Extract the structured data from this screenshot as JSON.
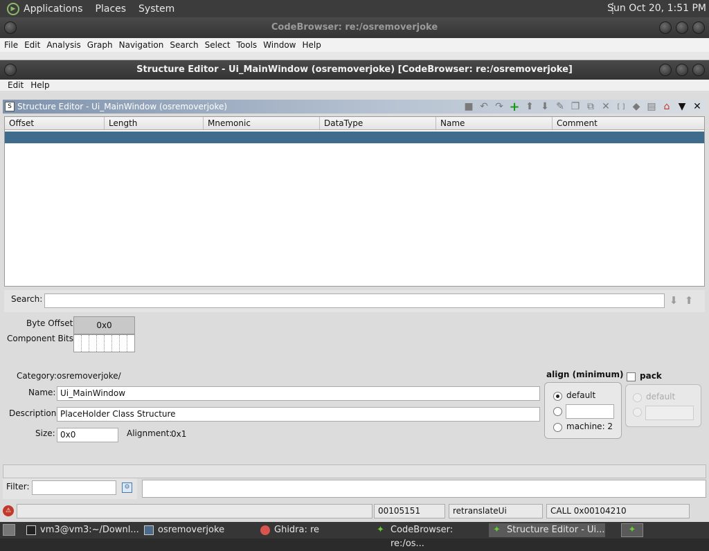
{
  "topbar": {
    "menus": [
      "Applications",
      "Places",
      "System"
    ],
    "clock": "Sun Oct 20,  1:51 PM"
  },
  "codebrowser": {
    "title": "CodeBrowser: re:/osremoverjoke",
    "menu": [
      "File",
      "Edit",
      "Analysis",
      "Graph",
      "Navigation",
      "Search",
      "Select",
      "Tools",
      "Window",
      "Help"
    ]
  },
  "structure_editor": {
    "title": "Structure Editor - Ui_MainWindow (osremoverjoke) [CodeBrowser: re:/osremoverjoke]",
    "menu": [
      "Edit",
      "Help"
    ],
    "panel_title": "Structure Editor - Ui_MainWindow (osremoverjoke)",
    "panel_icon": "structure-icon",
    "toolbar_icons": [
      "apply-icon",
      "undo-icon",
      "redo-icon",
      "add-icon",
      "move-up-icon",
      "move-down-icon",
      "duplicate-icon",
      "duplicate-multiple-icon",
      "unpackage-icon",
      "delete-icon",
      "array-icon",
      "create-pointer-icon",
      "show-components-icon",
      "home-icon",
      "menu-icon",
      "close-icon"
    ],
    "columns": [
      "Offset",
      "Length",
      "Mnemonic",
      "DataType",
      "Name",
      "Comment"
    ],
    "search_label": "Search:",
    "byte_offset_label": "Byte Offset:",
    "byte_offset_value": "0x0",
    "component_bits_label": "Component Bits:",
    "category_label": "Category:",
    "category_value": "osremoverjoke/",
    "name_label": "Name:",
    "name_value": "Ui_MainWindow",
    "description_label": "Description:",
    "description_value": "PlaceHolder Class Structure",
    "size_label": "Size:",
    "size_value": "0x0",
    "alignment_label": "Alignment:",
    "alignment_value": "0x1",
    "align_title": "align (minimum)",
    "align_options": [
      "default",
      "",
      "machine: 2"
    ],
    "pack_label": "pack",
    "pack_options": [
      "default",
      ""
    ],
    "filter_label": "Filter:"
  },
  "statusbar": {
    "address": "00105151",
    "function": "retranslateUi",
    "instruction": "CALL 0x00104210"
  },
  "taskbar": [
    {
      "label": "vm3@vm3:~/Downl...",
      "icon": "terminal-icon"
    },
    {
      "label": "osremoverjoke",
      "icon": "window-icon"
    },
    {
      "label": "Ghidra: re",
      "icon": "ghidra-icon"
    },
    {
      "label": "CodeBrowser: re:/os...",
      "icon": "dragon-icon"
    },
    {
      "label": "Structure Editor - Ui...",
      "icon": "dragon-icon"
    }
  ]
}
